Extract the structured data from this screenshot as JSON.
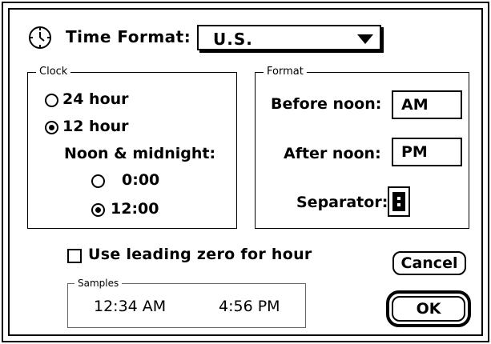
{
  "header": {
    "title_label": "Time Format:",
    "format_value": "U.S."
  },
  "clock_group": {
    "title": "Clock",
    "options": [
      {
        "label": "24 hour",
        "selected": false
      },
      {
        "label": "12 hour",
        "selected": true
      }
    ],
    "noon_midnight_label": "Noon & midnight:",
    "noon_options": [
      {
        "label": "0:00",
        "selected": false
      },
      {
        "label": "12:00",
        "selected": true
      }
    ]
  },
  "format_group": {
    "title": "Format",
    "before_noon_label": "Before noon:",
    "before_noon_value": "AM",
    "after_noon_label": "After noon:",
    "after_noon_value": "PM",
    "separator_label": "Separator:",
    "separator_value": ":"
  },
  "leading_zero": {
    "label": "Use leading zero for hour",
    "checked": false
  },
  "samples": {
    "title": "Samples",
    "am_sample": "12:34 AM",
    "pm_sample": "4:56 PM"
  },
  "buttons": {
    "cancel": "Cancel",
    "ok": "OK"
  }
}
